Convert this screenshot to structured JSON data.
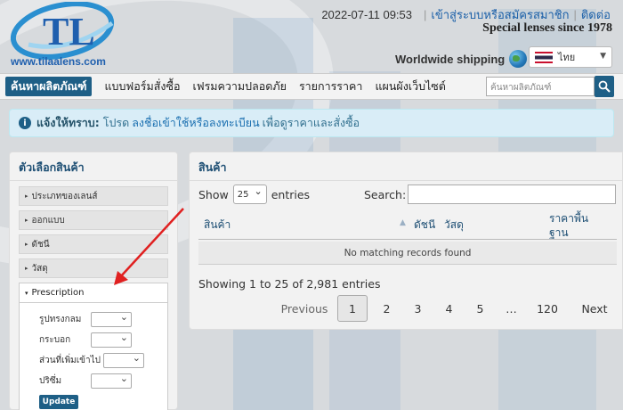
{
  "brand": {
    "logo_text": "TL",
    "url": "www.tilaalens.com",
    "colors": {
      "primary": "#1e5f86",
      "link": "#1a5fa8",
      "annotation": "#e02020"
    }
  },
  "topbar": {
    "datetime": "2022-07-11 09:53",
    "login_link": "เข้าสู่ระบบหรือสมัครสมาชิก",
    "contact_link": "ติดต่อ",
    "tagline": "Special lenses since 1978",
    "shipping": "Worldwide shipping",
    "language": "ไทย"
  },
  "nav": {
    "items": [
      "ค้นหาผลิตภัณฑ์",
      "แบบฟอร์มสั่งซื้อ",
      "เฟรมความปลอดภัย",
      "รายการราคา",
      "แผนผังเว็บไซต์"
    ],
    "search_placeholder": "ค้นหาผลิตภัณฑ์"
  },
  "notice": {
    "label": "แจ้งให้ทราบ:",
    "pre": "โปรด",
    "link": "ลงชื่อเข้าใช้หรือลงทะเบียน",
    "post": "เพื่อดูราคาและสั่งซื้อ"
  },
  "filters": {
    "title": "ตัวเลือกสินค้า",
    "sections": [
      "ประเภทของเลนส์",
      "ออกแบบ",
      "ดัชนี",
      "วัสดุ"
    ],
    "open_section": "Prescription",
    "fields": [
      "รูปทรงกลม",
      "กระบอก",
      "ส่วนที่เพิ่มเข้าไป",
      "ปริซึ่ม"
    ],
    "update_label": "Update"
  },
  "products": {
    "title": "สินค้า",
    "show_label": "Show",
    "page_length": "25",
    "entries_label": "entries",
    "search_label": "Search:",
    "columns": [
      "สินค้า",
      "ดัชนี",
      "วัสดุ",
      "ราคาพื้นฐาน"
    ],
    "empty_message": "No matching records found",
    "info": "Showing 1 to 25 of 2,981 entries",
    "pagination": {
      "prev": "Previous",
      "current": "1",
      "pages": [
        "2",
        "3",
        "4",
        "5"
      ],
      "ellipsis": "…",
      "last": "120",
      "next": "Next"
    }
  }
}
